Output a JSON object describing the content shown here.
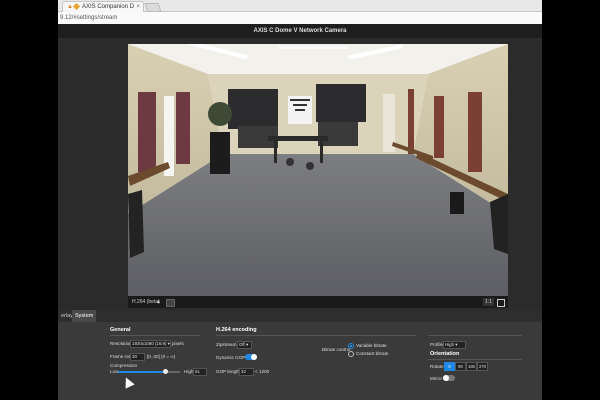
{
  "browser": {
    "tab_warning": "▲",
    "tab_title": "AXIS Companion De",
    "tab_close": "×",
    "address": "9.12/#settings/stream"
  },
  "app": {
    "camera_title": "AXIS C Dome V Network Camera"
  },
  "stream": {
    "stream_label": "H.264 (beta)",
    "stream_caret": "▲",
    "ratio": "1:1"
  },
  "panel": {
    "tabs": [
      "erlay",
      "System"
    ],
    "general": {
      "title": "General",
      "resolution_label": "Resolution",
      "resolution_value": "1920x1080 (16:9) ▾",
      "resolution_unit": "pixels",
      "framerate_label": "Frame rate",
      "framerate_value": "30",
      "framerate_hint": "[0..30] (0 = ∞)",
      "compression_label": "Compression",
      "low_label": "Low",
      "high_label": "High",
      "compression_value": "61",
      "compression_level": 0.75
    },
    "h264": {
      "title": "H.264 encoding",
      "zipstream_label": "Zipstream",
      "zipstream_value": "Off ▾",
      "dynamic_gop_label": "Dynamic GOP",
      "dynamic_gop_on": true,
      "gop_length_label": "GOP length",
      "gop_length_value": "32",
      "gop_length_max": "1200"
    },
    "bitrate": {
      "label": "Bitrate control",
      "variable": "Variable bitrate",
      "constant": "Constant bitrate"
    },
    "profile": {
      "label": "Profile",
      "value": "High ▾"
    },
    "orientation": {
      "title": "Orientation",
      "rotate_label": "Rotate",
      "rotate_options": [
        "0",
        "90",
        "180",
        "270"
      ],
      "mirror_label": "Mirror",
      "mirror_on": false
    }
  },
  "colors": {
    "accent": "#1e88e5",
    "panel_bg": "#3a3a3a",
    "app_bg": "#2b2b2b"
  }
}
